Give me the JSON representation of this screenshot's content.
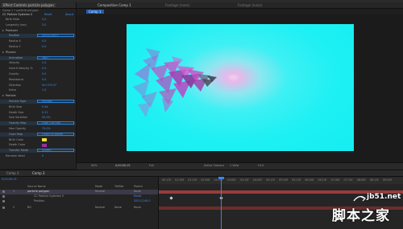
{
  "effect_controls": {
    "tab_label": "Effect Controls particle polygon",
    "header_text": "Comp 1 • particle polygon",
    "effect_name": "CC Particle Systems II",
    "reset_label": "Reset",
    "about_label": "About",
    "rows": [
      {
        "label": "Birth Rate",
        "value": "5.0",
        "indent": 1
      },
      {
        "label": "Longevity (sec)",
        "value": "3.0",
        "indent": 1
      },
      {
        "label": "Producer",
        "value": "",
        "indent": 1,
        "twirl": true
      },
      {
        "label": "Position",
        "value": "320.0,240.0",
        "indent": 2,
        "boxed": true
      },
      {
        "label": "Radius X",
        "value": "0.0",
        "indent": 2
      },
      {
        "label": "Radius Y",
        "value": "0.0",
        "indent": 2
      },
      {
        "label": "Physics",
        "value": "",
        "indent": 1,
        "twirl": true
      },
      {
        "label": "Animation",
        "value": "Twirl",
        "indent": 2,
        "boxed": true
      },
      {
        "label": "Velocity",
        "value": "2.0",
        "indent": 2
      },
      {
        "label": "Inherit Velocity %",
        "value": "0.0",
        "indent": 2
      },
      {
        "label": "Gravity",
        "value": "0.0",
        "indent": 2
      },
      {
        "label": "Resistance",
        "value": "0.0",
        "indent": 2
      },
      {
        "label": "Direction",
        "value": "0x+270.0°",
        "indent": 2
      },
      {
        "label": "Extra",
        "value": "1.0",
        "indent": 2
      },
      {
        "label": "Particle",
        "value": "",
        "indent": 1,
        "twirl": true
      },
      {
        "label": "Particle Type",
        "value": "Polygon",
        "indent": 2,
        "boxed": true
      },
      {
        "label": "Birth Size",
        "value": "0.44",
        "indent": 2
      },
      {
        "label": "Death Size",
        "value": "0.21",
        "indent": 2
      },
      {
        "label": "Size Variation",
        "value": "50.0%",
        "indent": 2
      },
      {
        "label": "Opacity Map",
        "value": "Fade Out Fast",
        "indent": 2,
        "boxed": true
      },
      {
        "label": "Max Opacity",
        "value": "75.0%",
        "indent": 2
      },
      {
        "label": "Color Map",
        "value": "Origin to Death",
        "indent": 2,
        "boxed": true
      },
      {
        "label": "Birth Color",
        "value": "",
        "indent": 2,
        "swatch": "#e6e23a"
      },
      {
        "label": "Death Color",
        "value": "",
        "indent": 2,
        "swatch": "#9a2f9a"
      },
      {
        "label": "Transfer Mode",
        "value": "Screen",
        "indent": 2,
        "boxed": true
      },
      {
        "label": "Random Seed",
        "value": "0",
        "indent": 1
      }
    ]
  },
  "composition": {
    "tab_label": "Composition Comp 1",
    "tab2_label": "Footage (none)",
    "tab3_label": "Footage (none)",
    "subtab_label": "Comp 1",
    "toolbar": {
      "zoom": "50%",
      "timecode": "0;00;00;15",
      "resolution": "Full",
      "camera": "Active Camera",
      "view": "1 View",
      "offset": "+0.0"
    }
  },
  "timeline": {
    "tabs": [
      "Comp 1",
      "Comp 2"
    ],
    "timecode": "0;00;00;15",
    "columns": {
      "source": "Source Name",
      "mode": "Mode",
      "trkmat": "TrkMat",
      "parent": "Parent"
    },
    "layers": [
      {
        "num": "1",
        "name": "particle polygon",
        "mode": "Normal",
        "trkmat": "",
        "parent": "None"
      },
      {
        "num": "",
        "name": "CC Particle Systems II",
        "mode": "",
        "trkmat": "",
        "parent": "Reset"
      },
      {
        "num": "",
        "name": "Position",
        "mode": "",
        "trkmat": "",
        "parent": "320.0,240.0"
      },
      {
        "num": "2",
        "name": "BG",
        "mode": "Normal",
        "trkmat": "None",
        "parent": "None"
      }
    ],
    "ruler": [
      "00:15f",
      "01:00f",
      "01:15f",
      "02:00f",
      "02:15f",
      "03:00f",
      "03:15f",
      "04:00f",
      "04:15f",
      "05:00f",
      "05:15f",
      "06:00f",
      "06:15f",
      "07:00f",
      "07:15f",
      "08:00f",
      "08:15f",
      "09:00f"
    ]
  },
  "watermark": {
    "site": "jb51.net",
    "chinese": "脚本之家"
  },
  "colors": {
    "accent": "#3a86e8",
    "canvas": "#14eef2",
    "particle": "#c040c0",
    "bar": "#9b3b3b"
  }
}
